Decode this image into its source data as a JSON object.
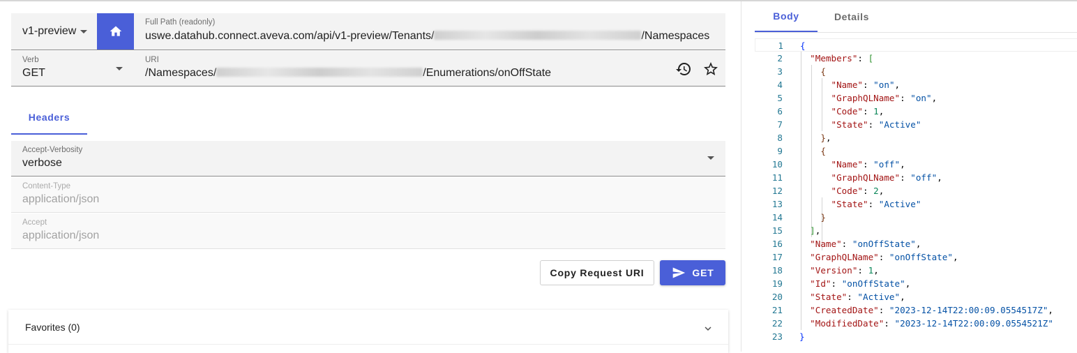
{
  "request": {
    "version": "v1-preview",
    "full_path_label": "Full Path (readonly)",
    "full_path_prefix": "uswe.datahub.connect.aveva.com/api/v1-preview/Tenants/",
    "full_path_suffix": "/Namespaces",
    "verb_label": "Verb",
    "verb_value": "GET",
    "uri_label": "URI",
    "uri_prefix": "/Namespaces/",
    "uri_suffix": "/Enumerations/onOffState"
  },
  "tabs": {
    "headers": "Headers"
  },
  "headers": [
    {
      "label": "Accept-Verbosity",
      "value": "verbose"
    },
    {
      "label": "Content-Type",
      "value": "application/json"
    },
    {
      "label": "Accept",
      "value": "application/json"
    }
  ],
  "actions": {
    "copy": "Copy Request URI",
    "send": "GET"
  },
  "favorites": {
    "title": "Favorites (0)"
  },
  "response": {
    "tabs": [
      "Body",
      "Details"
    ],
    "line_numbers": [
      "1",
      "2",
      "3",
      "4",
      "5",
      "6",
      "7",
      "8",
      "9",
      "10",
      "11",
      "12",
      "13",
      "14",
      "15",
      "16",
      "17",
      "18",
      "19",
      "20",
      "21",
      "22",
      "23"
    ],
    "body": {
      "Members": [
        {
          "Name": "on",
          "GraphQLName": "on",
          "Code": 1,
          "State": "Active"
        },
        {
          "Name": "off",
          "GraphQLName": "off",
          "Code": 2,
          "State": "Active"
        }
      ],
      "Name": "onOffState",
      "GraphQLName": "onOffState",
      "Version": 1,
      "Id": "onOffState",
      "State": "Active",
      "CreatedDate": "2023-12-14T22:00:09.0554517Z",
      "ModifiedDate": "2023-12-14T22:00:09.0554521Z"
    }
  },
  "colors": {
    "accent": "#4a5fd8",
    "json_key": "#a31515",
    "json_string": "#0451a5",
    "json_number": "#098658"
  },
  "icons": {
    "home": "home-icon",
    "history": "history-icon",
    "favorite": "star-outline-icon",
    "send": "send-icon",
    "expand": "chevron-down-icon"
  }
}
